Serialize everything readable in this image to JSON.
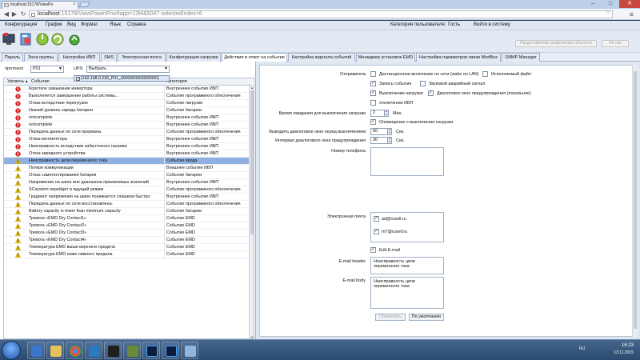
{
  "browser": {
    "tab_title": "localhost:15178/ViewPo",
    "tab_close": "×",
    "url_host": "localhost",
    "url_path": ":15178/ViewPowerPro/#app=13f4&5047-selectedIndex=6",
    "back": "◀",
    "forward": "▶",
    "reload": "↻",
    "star": "☆",
    "menu": "≡",
    "min": "–",
    "max": "□",
    "close": "✕"
  },
  "app": {
    "menu": [
      "Конфигурация",
      "График",
      "Вид",
      "Формат",
      "Язык",
      "Справка"
    ],
    "user_category_label": "Категория пользователя:",
    "user_category_value": "Гость",
    "login_link": "Войти в систему",
    "toolbar_right_buttons": [
      "Представление графических объектов",
      "Не нас"
    ],
    "tabs": [
      "Пароль",
      "Зона группы",
      "Настройка ИБП",
      "SMS",
      "Электронная почта",
      "Конфигурация нагрузки",
      "Действия в ответ на событие",
      "Настройка журнала событий",
      "Менеджер установок EMD",
      "Настройка параметров связи ModBus",
      "SNMP Manager"
    ],
    "active_tab_index": 6
  },
  "left": {
    "protocol_label": "протокол",
    "protocol_value": "P01",
    "ups_label": "UPS",
    "ups_value": "Выбрать",
    "dropdown_item": "(192.168.0.230_P01_0000000000000000)",
    "dropdown_checked": "✓",
    "headers": [
      "Уровень ▴",
      "Событие",
      "Категория"
    ],
    "rows": [
      {
        "sev": "error",
        "event": "Короткое замыкание инвертора",
        "cat": "Внутреннее событие ИБП"
      },
      {
        "sev": "error",
        "event": "Выполняется завершение работы системы...",
        "cat": "Событие программного обеспечения"
      },
      {
        "sev": "error",
        "event": "Отказ вследствие перегрузки",
        "cat": "Событие нагрузки"
      },
      {
        "sev": "error",
        "event": "Низкий уровень заряда батареи",
        "cat": "Событие батареи"
      },
      {
        "sev": "error",
        "event": "notcomplete",
        "cat": "Внутреннее событие ИБП"
      },
      {
        "sev": "error",
        "event": "notcomplete",
        "cat": "Внутреннее событие ИБП"
      },
      {
        "sev": "error",
        "event": "Передача данных по сети прервана.",
        "cat": "Событие программного обеспечения"
      },
      {
        "sev": "error",
        "event": "Отказ вентилятора",
        "cat": "Внутреннее событие ИБП"
      },
      {
        "sev": "error",
        "event": "Неисправность вследствие избыточного нагрева",
        "cat": "Внутреннее событие ИБП"
      },
      {
        "sev": "error",
        "event": "Отказ зарядного устройства",
        "cat": "Внутреннее событие ИБП"
      },
      {
        "sev": "warn",
        "event": "Неисправность цепи переменного тока",
        "cat": "Событие ввода",
        "selected": true
      },
      {
        "sev": "warn",
        "event": "Потеря коммуникации",
        "cat": "Внешнее событие ИБП"
      },
      {
        "sev": "warn",
        "event": "Отказ самотестирования батареи",
        "cat": "Событие батареи"
      },
      {
        "sev": "warn",
        "event": "Напряжение на шине вне диапазона приемлемых значений",
        "cat": "Внутреннее событие ИБП"
      },
      {
        "sev": "warn",
        "event": "SCsystem перейдёт в ждущий режим",
        "cat": "Событие программного обеспечения"
      },
      {
        "sev": "warn",
        "event": "Градиент напряжения на шине понижается слишком быстро",
        "cat": "Внутреннее событие ИБП"
      },
      {
        "sev": "warn",
        "event": "Передача данных по сети восстановлена.",
        "cat": "Событие программного обеспечения"
      },
      {
        "sev": "warn",
        "event": "Battery capacity is lower than minimum capacity",
        "cat": "Событие батареи"
      },
      {
        "sev": "warn",
        "event": "Тревога «EMD Dry Contact1»",
        "cat": "Событие EMD"
      },
      {
        "sev": "warn",
        "event": "Тревога «EMD Dry Contact2»",
        "cat": "Событие EMD"
      },
      {
        "sev": "warn",
        "event": "Тревога «EMD Dry Contact3»",
        "cat": "Событие EMD"
      },
      {
        "sev": "warn",
        "event": "Тревога «EMD Dry Contact4»",
        "cat": "Событие EMD"
      },
      {
        "sev": "warn",
        "event": "Температура EMD выше верхнего предела",
        "cat": "Событие EMD"
      },
      {
        "sev": "warn",
        "event": "Температура EMD ниже нижнего предела",
        "cat": "Событие EMD"
      }
    ]
  },
  "right": {
    "sender_label": "Отправитель",
    "checks": {
      "remote": {
        "label": "Дистанционное включение по сети (wake on LAN)",
        "checked": false
      },
      "exec": {
        "label": "Исполняемый файл",
        "checked": false
      },
      "log": {
        "label": "Запись события",
        "checked": true
      },
      "sound": {
        "label": "Звуковой аварийный сигнал",
        "checked": false
      },
      "load_off": {
        "label": "Выключение нагрузки",
        "checked": true
      },
      "dialog": {
        "label": "Диалоговое окно предупреждения (локальное)",
        "checked": true
      },
      "ups_off": {
        "label": "отключение ИБП",
        "checked": false
      },
      "notify": {
        "label": "Оповещение о выключении нагрузки",
        "checked": true
      },
      "edit_email": {
        "label": "Edit E-mail",
        "checked": true
      }
    },
    "wait_label": "Время ожидания для выключения нагрузки",
    "wait_value": "2",
    "wait_unit": "Мин.",
    "dialog_before_label": "Выводить диалоговое окно перед выключением",
    "dialog_before_value": "60",
    "dialog_before_unit": "Сек.",
    "interval_label": "Интервал диалогового окна предупреждения",
    "interval_value": "30",
    "interval_unit": "Сек.",
    "phone_label": "Номер телефона",
    "email_label": "Электронная почта",
    "emails": [
      "ad@rusell.ru",
      "m7@rusell.ru"
    ],
    "email_header_label": "E-mail header",
    "email_header_value": "Неисправность цепи переменного тока",
    "email_body_label": "E-mail body",
    "email_body_value": "Неисправность цепи переменного тока",
    "apply_button": "Применить",
    "default_button": "По умолчанию"
  },
  "taskbar": {
    "lang": "RU",
    "time": "16:23",
    "date": "13.11.2015"
  },
  "colors": {
    "error": "#d92626",
    "warn": "#f2c200",
    "selected_row": "#8fb0e0"
  }
}
